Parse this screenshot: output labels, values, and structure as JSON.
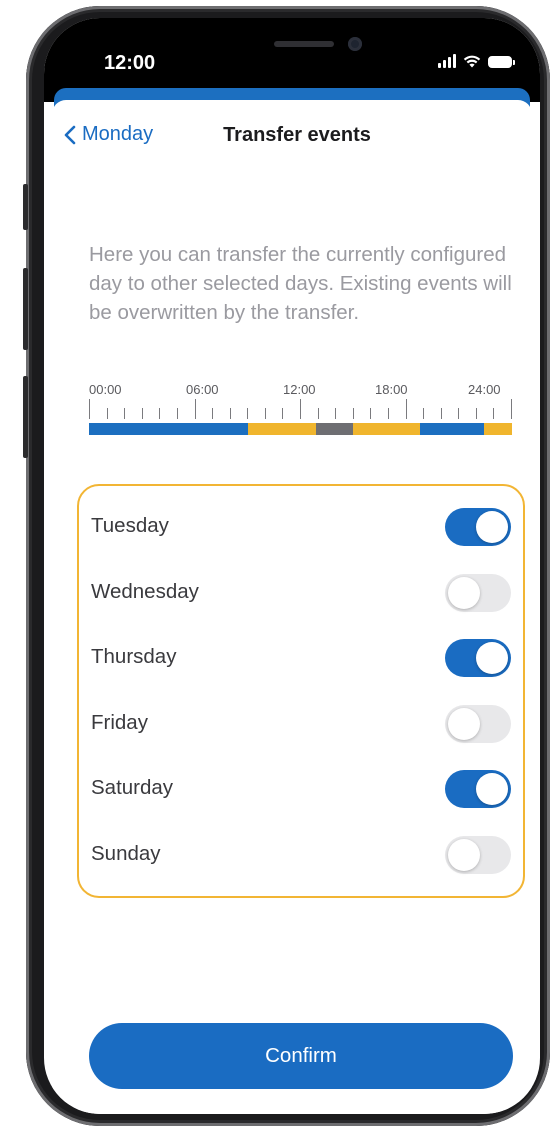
{
  "status": {
    "time": "12:00"
  },
  "nav": {
    "back_label": "Monday",
    "title": "Transfer events"
  },
  "description": "Here you can transfer the currently configured day to other selected days. Existing events will be overwritten by the transfer.",
  "timeline": {
    "labels": [
      "00:00",
      "06:00",
      "12:00",
      "18:00",
      "24:00"
    ],
    "segments": [
      {
        "from_hour": 0,
        "to_hour": 9,
        "color": "#1c6fc0"
      },
      {
        "from_hour": 9,
        "to_hour": 12.9,
        "color": "#f0b52d"
      },
      {
        "from_hour": 12.9,
        "to_hour": 15,
        "color": "#6e6e72"
      },
      {
        "from_hour": 15,
        "to_hour": 18.8,
        "color": "#f0b52d"
      },
      {
        "from_hour": 18.8,
        "to_hour": 22.4,
        "color": "#1c6fc0"
      },
      {
        "from_hour": 22.4,
        "to_hour": 24,
        "color": "#f0b52d"
      }
    ]
  },
  "days": [
    {
      "label": "Tuesday",
      "on": true
    },
    {
      "label": "Wednesday",
      "on": false
    },
    {
      "label": "Thursday",
      "on": true
    },
    {
      "label": "Friday",
      "on": false
    },
    {
      "label": "Saturday",
      "on": true
    },
    {
      "label": "Sunday",
      "on": false
    }
  ],
  "confirm_label": "Confirm",
  "colors": {
    "accent": "#1a6cc2",
    "highlight_border": "#f2b534"
  }
}
